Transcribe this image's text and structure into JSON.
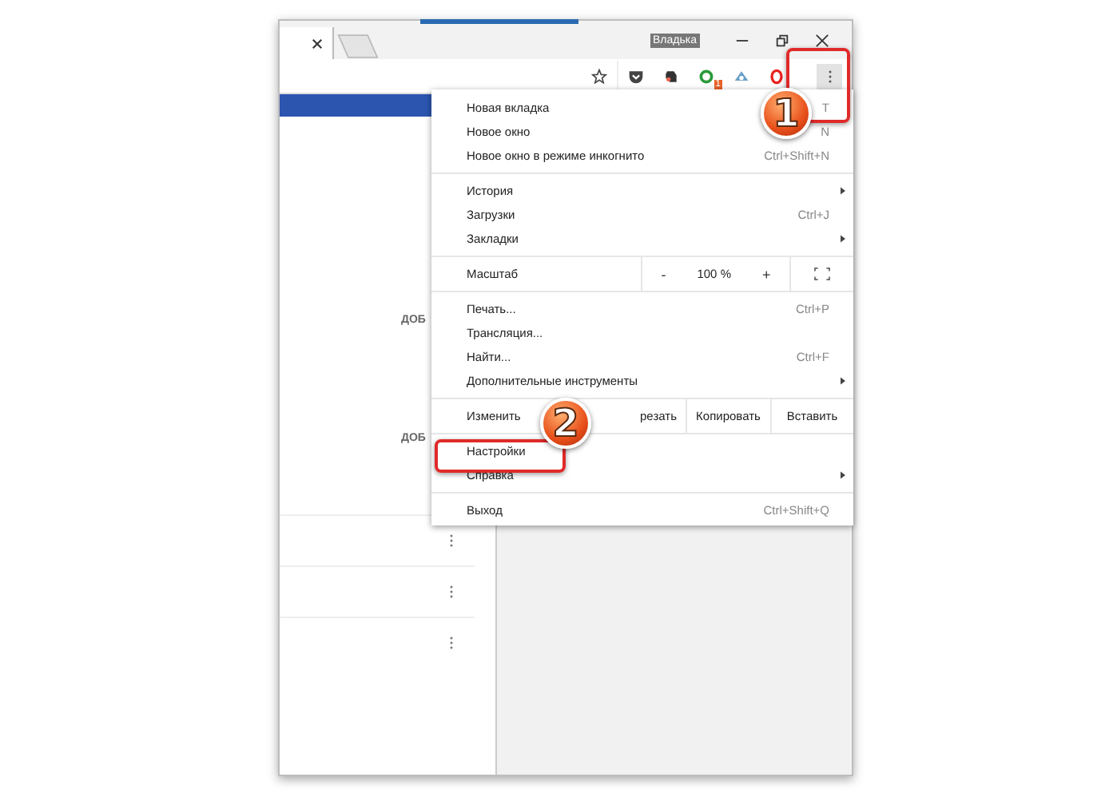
{
  "window": {
    "user": "Владька"
  },
  "toolbar": {
    "extension_badge": "1"
  },
  "content": {
    "left_labels": [
      "ДОБ",
      "ДОБ"
    ]
  },
  "menu": {
    "sections": [
      {
        "items": [
          {
            "kind": "item",
            "label": "Новая вкладка",
            "shortcut": "T",
            "submenu": false
          },
          {
            "kind": "item",
            "label": "Новое окно",
            "shortcut": "N",
            "submenu": false
          },
          {
            "kind": "item",
            "label": "Новое окно в режиме инкогнито",
            "shortcut": "Ctrl+Shift+N",
            "submenu": false
          }
        ]
      },
      {
        "items": [
          {
            "kind": "item",
            "label": "История",
            "submenu": true
          },
          {
            "kind": "item",
            "label": "Загрузки",
            "shortcut": "Ctrl+J",
            "submenu": false
          },
          {
            "kind": "item",
            "label": "Закладки",
            "submenu": true
          }
        ]
      },
      {
        "items": [
          {
            "kind": "zoom",
            "label": "Масштаб",
            "minus": "-",
            "value": "100 %",
            "plus": "+"
          }
        ]
      },
      {
        "items": [
          {
            "kind": "item",
            "label": "Печать...",
            "shortcut": "Ctrl+P",
            "submenu": false
          },
          {
            "kind": "item",
            "label": "Трансляция...",
            "submenu": false
          },
          {
            "kind": "item",
            "label": "Найти...",
            "shortcut": "Ctrl+F",
            "submenu": false
          },
          {
            "kind": "item",
            "label": "Дополнительные инструменты",
            "submenu": true
          }
        ]
      },
      {
        "items": [
          {
            "kind": "edit",
            "label": "Изменить",
            "buttons": [
              "резать",
              "Копировать",
              "Вставить"
            ]
          }
        ]
      },
      {
        "items": [
          {
            "kind": "item",
            "label": "Настройки",
            "submenu": false
          },
          {
            "kind": "item",
            "label": "Справка",
            "submenu": true
          }
        ]
      },
      {
        "items": [
          {
            "kind": "item",
            "label": "Выход",
            "shortcut": "Ctrl+Shift+Q",
            "submenu": false
          }
        ]
      }
    ]
  },
  "annotations": [
    {
      "label": "1"
    },
    {
      "label": "2"
    }
  ]
}
